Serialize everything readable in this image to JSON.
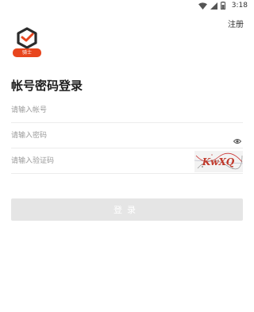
{
  "status_bar": {
    "time": "3:18"
  },
  "header": {
    "register_label": "注册"
  },
  "logo": {
    "badge_text": "骑士",
    "colors": {
      "accent": "#e8461e",
      "dark": "#2b2b2b"
    }
  },
  "form": {
    "title": "帐号密码登录",
    "account_placeholder": "请输入帐号",
    "password_placeholder": "请输入密码",
    "captcha_placeholder": "请输入验证码",
    "captcha_text": "KwXQ",
    "login_label": "登录"
  },
  "icons": {
    "eye": "eye-icon",
    "wifi": "wifi-icon",
    "battery": "battery-icon"
  }
}
